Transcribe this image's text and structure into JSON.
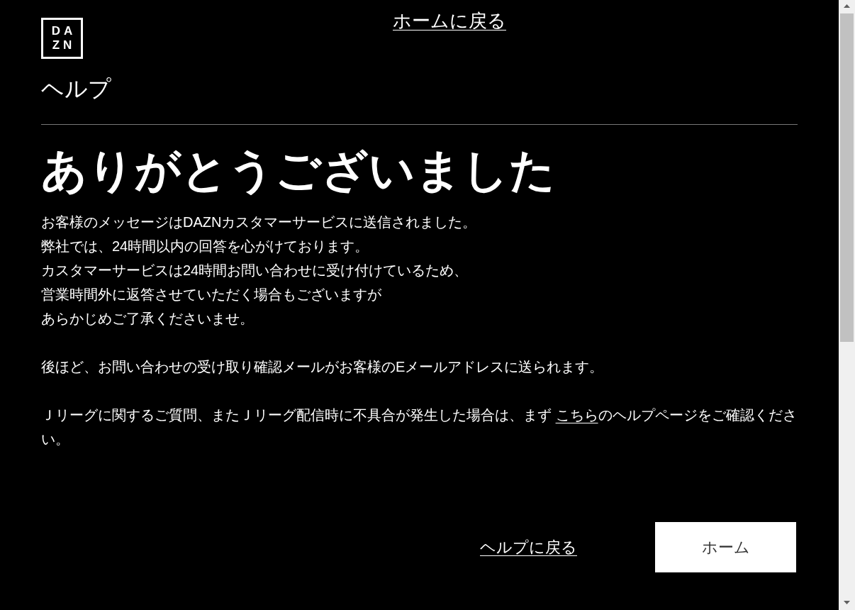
{
  "logo": {
    "top": "DA",
    "bottom": "ZN"
  },
  "home_link": "ホームに戻る",
  "section_title": "ヘルプ",
  "heading": "ありがとうございました",
  "message_lines": [
    "お客様のメッセージはDAZNカスタマーサービスに送信されました。",
    "弊社では、24時間以内の回答を心がけております。",
    "カスタマーサービスは24時間お問い合わせに受け付けているため、",
    "営業時間外に返答させていただく場合もございますが",
    "あらかじめご了承くださいませ。"
  ],
  "confirmation_note": "後ほど、お問い合わせの受け取り確認メールがお客様のEメールアドレスに送られます。",
  "jleague_note": {
    "before": "Ｊリーグに関するご質問、またＪリーグ配信時に不具合が発生した場合は、まず ",
    "link": "こちら",
    "after": "のヘルプページをご確認ください。"
  },
  "back_to_help_link": "ヘルプに戻る",
  "home_button": "ホーム"
}
